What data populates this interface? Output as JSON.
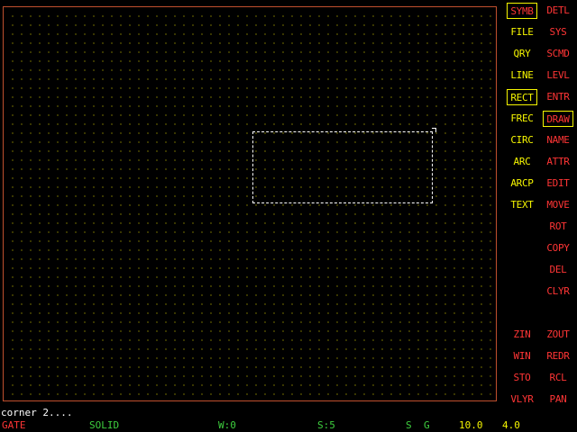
{
  "colors": {
    "frame": "#c0502e",
    "grid_dot": "#cfc800",
    "menu_yellow": "#f5f500",
    "menu_red": "#ff3535",
    "status_green": "#3ecf3e",
    "status_red": "#ff3535",
    "status_white": "#ffffff",
    "status_yellow": "#f5f500",
    "shape_stroke": "#ffffff"
  },
  "menu": {
    "left": [
      {
        "label": "SYMB",
        "color": "red",
        "boxed": true
      },
      {
        "label": "FILE",
        "color": "yellow",
        "boxed": false
      },
      {
        "label": "QRY",
        "color": "yellow",
        "boxed": false
      },
      {
        "label": "LINE",
        "color": "yellow",
        "boxed": false
      },
      {
        "label": "RECT",
        "color": "yellow",
        "boxed": true
      },
      {
        "label": "FREC",
        "color": "yellow",
        "boxed": false
      },
      {
        "label": "CIRC",
        "color": "yellow",
        "boxed": false
      },
      {
        "label": "ARC",
        "color": "yellow",
        "boxed": false
      },
      {
        "label": "ARCP",
        "color": "yellow",
        "boxed": false
      },
      {
        "label": "TEXT",
        "color": "yellow",
        "boxed": false
      },
      {
        "label": "ZIN",
        "color": "red",
        "boxed": false
      },
      {
        "label": "WIN",
        "color": "red",
        "boxed": false
      },
      {
        "label": "STO",
        "color": "red",
        "boxed": false
      },
      {
        "label": "VLYR",
        "color": "red",
        "boxed": false
      }
    ],
    "right": [
      {
        "label": "DETL",
        "color": "red",
        "boxed": false
      },
      {
        "label": "SYS",
        "color": "red",
        "boxed": false
      },
      {
        "label": "SCMD",
        "color": "red",
        "boxed": false
      },
      {
        "label": "LEVL",
        "color": "red",
        "boxed": false
      },
      {
        "label": "ENTR",
        "color": "red",
        "boxed": false
      },
      {
        "label": "DRAW",
        "color": "red",
        "boxed": true
      },
      {
        "label": "NAME",
        "color": "red",
        "boxed": false
      },
      {
        "label": "ATTR",
        "color": "red",
        "boxed": false
      },
      {
        "label": "EDIT",
        "color": "red",
        "boxed": false
      },
      {
        "label": "MOVE",
        "color": "red",
        "boxed": false
      },
      {
        "label": "ROT",
        "color": "red",
        "boxed": false
      },
      {
        "label": "COPY",
        "color": "red",
        "boxed": false
      },
      {
        "label": "DEL",
        "color": "red",
        "boxed": false
      },
      {
        "label": "CLYR",
        "color": "red",
        "boxed": false
      },
      {
        "label": "ZOUT",
        "color": "red",
        "boxed": false
      },
      {
        "label": "REDR",
        "color": "red",
        "boxed": false
      },
      {
        "label": "RCL",
        "color": "red",
        "boxed": false
      },
      {
        "label": "PAN",
        "color": "red",
        "boxed": false
      }
    ]
  },
  "prompt": "corner 2....",
  "status": {
    "layer": "GATE",
    "line_style": "SOLID",
    "width": "W:0",
    "snap": "S:5",
    "flags_s": "S",
    "flags_g": "G",
    "grid_value": "10.0",
    "scale_value": "4.0"
  }
}
